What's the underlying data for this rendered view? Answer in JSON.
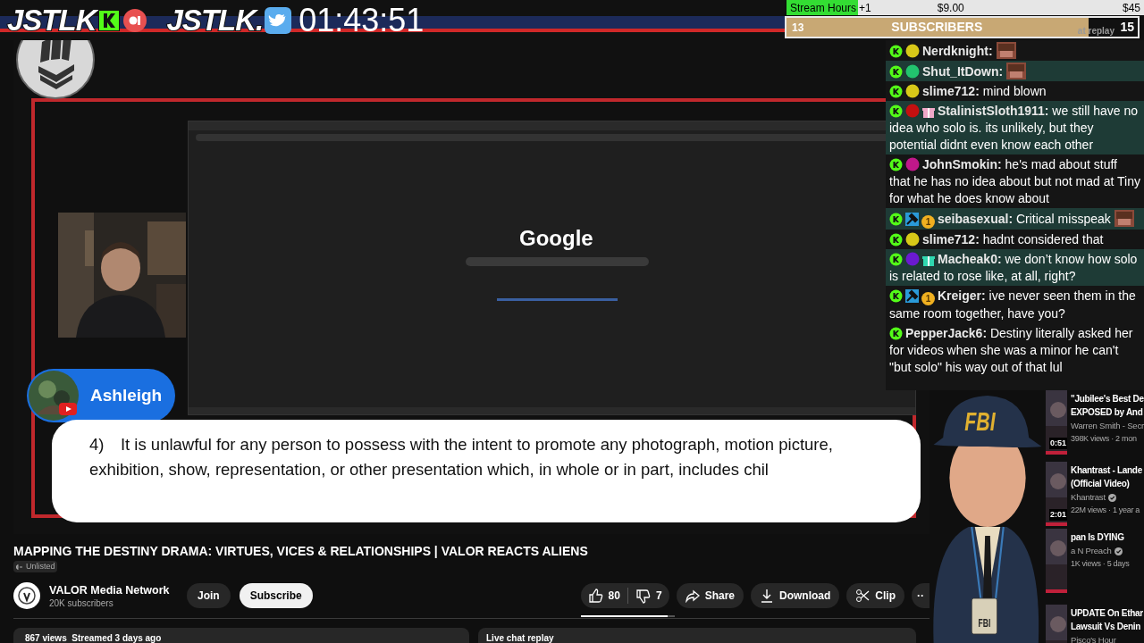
{
  "overlay_header": {
    "logo_1": "JSTLK",
    "logo_2": "JSTLK.",
    "timer": "01:43:51"
  },
  "goal_bar": {
    "label": "Stream Hours",
    "increment": "+1",
    "amount": "$9.00",
    "goal": "$45",
    "level": 0.2
  },
  "subscribers_bar": {
    "count": "13",
    "label": "SUBSCRIBERS",
    "goal": "15",
    "behind_text": "at replay",
    "level": 0.86
  },
  "chat": [
    {
      "name": "Nerdknight:",
      "highlighted": false,
      "color": "#d8c818",
      "emote": true
    },
    {
      "name": "Shut_ItDown:",
      "highlighted": true,
      "color": "#22c46e",
      "emote": true
    },
    {
      "name": "slime712:",
      "message": "mind blown",
      "highlighted": false,
      "color": "#d8c818",
      "emote": false
    },
    {
      "name": "StalinistSloth1911:",
      "message": "we still have no idea who solo is. its unlikely, but they potential didnt even know each other",
      "highlighted": true,
      "color": "#c41010",
      "badges": [
        {
          "kind": "gift",
          "color": "#f0a8c8"
        }
      ],
      "emote": false
    },
    {
      "name": "JohnSmokin:",
      "message": "he's mad about stuff that he has no idea about but not mad at Tiny for what he does know about",
      "highlighted": false,
      "color": "#c0188a",
      "emote": false
    },
    {
      "name": "seibasexual:",
      "message": "Critical misspeak",
      "highlighted": true,
      "badges": [
        {
          "kind": "hammer"
        },
        {
          "kind": "tier",
          "label": "1"
        }
      ],
      "emote": true
    },
    {
      "name": "slime712:",
      "message": "hadnt considered that",
      "highlighted": false,
      "color": "#d8c818",
      "emote": false
    },
    {
      "name": "Macheak0:",
      "message": "we don’t know how solo is related to rose like, at all, right?",
      "highlighted": true,
      "color": "#6a1ad0",
      "badges": [
        {
          "kind": "gift",
          "color": "#30d8b0"
        }
      ],
      "emote": false
    },
    {
      "name": "Kreiger:",
      "message": "ive never seen them in the same room together, have you?",
      "highlighted": false,
      "badges": [
        {
          "kind": "hammer"
        },
        {
          "kind": "tier",
          "label": "1"
        }
      ],
      "emote": false
    },
    {
      "name": "PepperJack6:",
      "message": "Destiny literally asked her for videos when she was a minor he can't \"but solo\" his way out of that lul",
      "highlighted": false,
      "emote": false
    }
  ],
  "video": {
    "browser_logo": "Google",
    "guest_name": "Ashleigh",
    "caption_number": "4)",
    "caption": "It is unlawful for any person to possess with the intent to promote any photograph, motion picture, exhibition, show, representation, or other presentation which, in whole or in part, includes chil"
  },
  "video_info": {
    "title": "MAPPING THE DESTINY DRAMA: VIRTUES, VICES & RELATIONSHIPS | VALOR REACTS ALIENS",
    "visibility": "Unlisted",
    "channel": "VALOR Media Network",
    "subscribers": "20K subscribers",
    "join": "Join",
    "subscribe": "Subscribe",
    "likes": "80",
    "dislikes": "7",
    "share": "Share",
    "download": "Download",
    "clip": "Clip",
    "more": "··",
    "description": "867 views  Streamed 3 days ago",
    "live_chat": "Live chat replay"
  },
  "related": [
    {
      "title_lines": [
        "\"Jubilee's Best De",
        "EXPOSED by And"
      ],
      "channel": "Warren Smith - Secr",
      "meta": "398K views · 2 mon",
      "duration": "0:51",
      "verified": false
    },
    {
      "title_lines": [
        "Khantrast - Lande",
        "(Official Video)"
      ],
      "channel": "Khantrast",
      "meta": "22M views · 1 year a",
      "duration": "2:01",
      "verified": true
    },
    {
      "title_lines": [
        "pan Is DYING"
      ],
      "channel": "a N Preach",
      "meta": "1K views · 5 days",
      "verified": true
    },
    {
      "title_lines": [
        "UPDATE On Ethar",
        "Lawsuit Vs Denin"
      ],
      "channel": "Pisco's Hour",
      "verified": false
    }
  ],
  "figure": {
    "cap_text": "FBI",
    "badge_text": "FBI"
  }
}
